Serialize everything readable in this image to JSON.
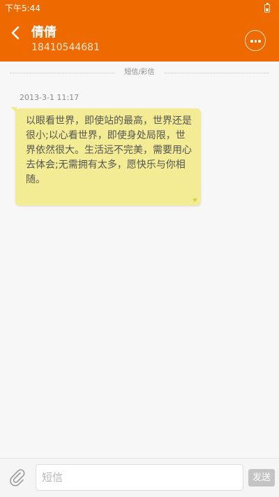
{
  "status_bar": {
    "time": "下午5:44",
    "battery_icon": "battery-icon"
  },
  "header": {
    "contact_name": "倩倩",
    "phone_number": "18410544681",
    "back_icon": "chevron-left-icon",
    "more_icon": "more-icon"
  },
  "conversation": {
    "divider_label": "短信/彩信",
    "messages": [
      {
        "timestamp": "2013-3-1 11:17",
        "text": "以眼看世界，即使站的最高，世界还是很小;以心看世界，即使身处局限，世界依然很大。生活远不完美，需要用心去体会;无需拥有太多，愿快乐与你相随。",
        "starred": true,
        "star_icon": "star-icon"
      }
    ]
  },
  "composer": {
    "attach_icon": "paperclip-icon",
    "input_value": "",
    "input_placeholder": "短信",
    "send_label": "发送"
  },
  "colors": {
    "brand": "#ee6a00",
    "bubble": "#f3ec94",
    "background": "#f7f7f7"
  }
}
